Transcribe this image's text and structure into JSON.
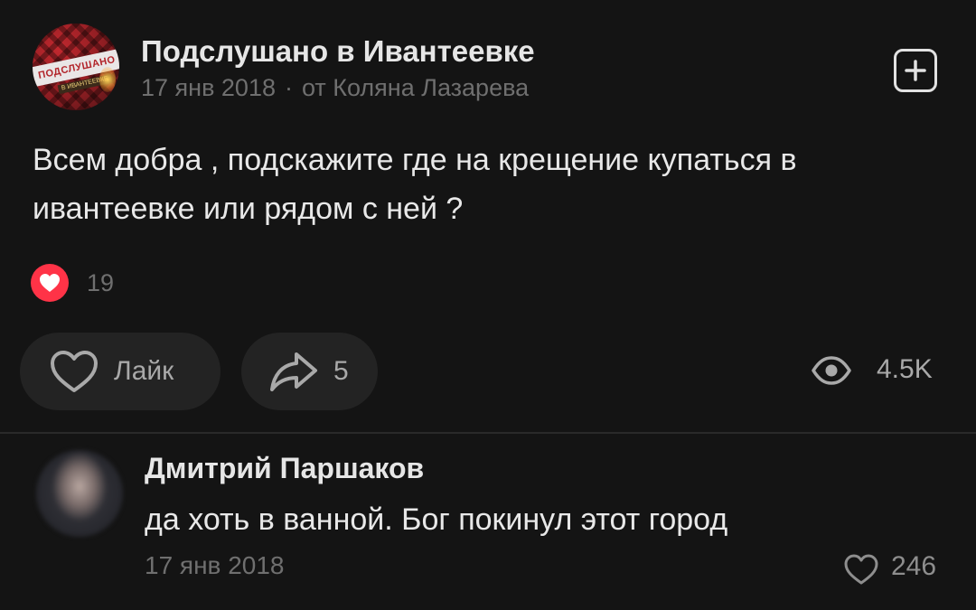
{
  "post": {
    "group_name": "Подслушано в Ивантеевке",
    "avatar_text": "ПОДСЛУШАНО",
    "avatar_subtext": "В ИВАНТЕЕВКЕ",
    "date": "17 янв 2018",
    "separator": "·",
    "author": "от Коляна Лазарева",
    "add_icon": "plus-square-icon",
    "text": "Всем добра , подскажите где на крещение купаться в ивантеевке или рядом с ней ?",
    "reaction_icon": "heart-icon",
    "reaction_count": "19",
    "reaction_color": "#ff3347",
    "like_label": "Лайк",
    "share_count": "5",
    "views_count": "4.5K"
  },
  "comment": {
    "author": "Дмитрий Паршаков",
    "text": "да хоть в ванной. Бог покинул этот город",
    "date": "17 янв 2018",
    "like_count": "246"
  },
  "colors": {
    "background": "#141414",
    "button_background": "#232323",
    "secondary_text": "#6f6f6f"
  }
}
